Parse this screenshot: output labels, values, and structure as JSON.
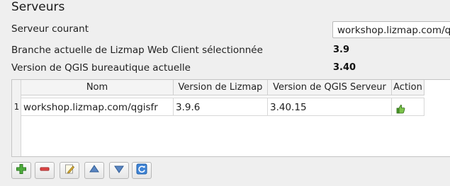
{
  "section_title": "Serveurs",
  "current_server": {
    "label": "Serveur courant",
    "value": "workshop.lizmap.com/qgisfr"
  },
  "branch": {
    "label": "Branche actuelle de Lizmap Web Client sélectionnée",
    "value": "3.9"
  },
  "qgis_desktop": {
    "label": "Version de QGIS bureautique actuelle",
    "value": "3.40"
  },
  "table": {
    "columns": [
      "Nom",
      "Version de Lizmap",
      "Version de QGIS Serveur",
      "Action"
    ],
    "rows": [
      {
        "index": "1",
        "name": "workshop.lizmap.com/qgisfr",
        "lizmap_version": "3.9.6",
        "qgis_server_version": "3.40.15",
        "action_icon": "thumbs-up-icon"
      }
    ]
  },
  "toolbar": {
    "buttons": [
      {
        "name": "add-server-button",
        "icon": "plus-icon"
      },
      {
        "name": "remove-server-button",
        "icon": "minus-icon"
      },
      {
        "name": "edit-server-button",
        "icon": "pencil-icon"
      },
      {
        "name": "move-up-button",
        "icon": "arrow-up-icon"
      },
      {
        "name": "move-down-button",
        "icon": "arrow-down-icon"
      },
      {
        "name": "refresh-button",
        "icon": "refresh-icon"
      }
    ]
  },
  "colors": {
    "add_green": "#3a9b2e",
    "remove_red": "#d23b3b",
    "arrow_blue": "#3f6ea8",
    "refresh_blue": "#2f74c6"
  }
}
